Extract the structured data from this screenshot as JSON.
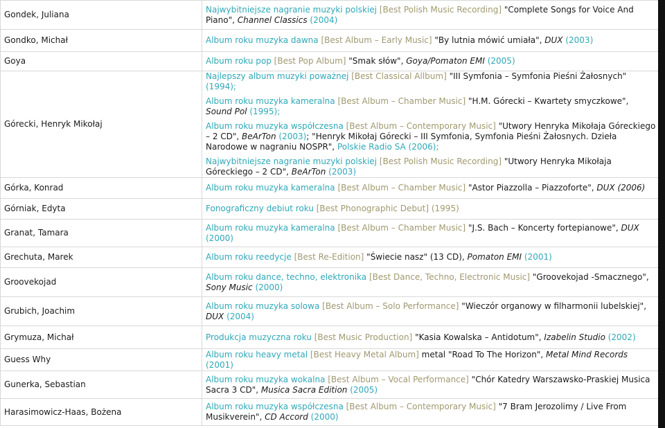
{
  "rows": [
    {
      "name": "Gondek, Juliana",
      "h": 42,
      "entries": [
        [
          {
            "t": "Najwybitniejsze nagranie muzyki polskiej",
            "c": "cat"
          },
          {
            "t": " [Best Polish Music Recording] ",
            "c": "en"
          },
          {
            "t": "\"Complete Songs for Voice And Piano\", ",
            "c": "pr"
          },
          {
            "t": "Channel Classics",
            "c": "lb"
          },
          {
            "t": " (2004)",
            "c": "yr"
          }
        ]
      ]
    },
    {
      "name": "Gondko, Michał",
      "h": 32,
      "entries": [
        [
          {
            "t": "Album roku muzyka dawna",
            "c": "cat"
          },
          {
            "t": " [Best Album – Early Music] ",
            "c": "en"
          },
          {
            "t": "\"By lutnia mówić umiała\", ",
            "c": "pr"
          },
          {
            "t": "DUX",
            "c": "lb"
          },
          {
            "t": " (2003)",
            "c": "yr"
          }
        ]
      ]
    },
    {
      "name": "Goya",
      "h": 28,
      "entries": [
        [
          {
            "t": "Album roku pop",
            "c": "cat"
          },
          {
            "t": " [Best Pop Album] ",
            "c": "en"
          },
          {
            "t": "\"Smak słów\", ",
            "c": "pr"
          },
          {
            "t": "Goya/Pomaton EMI",
            "c": "lb"
          },
          {
            "t": " (2005)",
            "c": "yr"
          }
        ]
      ]
    },
    {
      "name": "Górecki, Henryk Mikołaj",
      "h": 150,
      "entries": [
        [
          {
            "t": "Najlepszy album muzyki poważnej",
            "c": "cat"
          },
          {
            "t": " [Best Classical Allbum] ",
            "c": "en"
          },
          {
            "t": "\"III Symfonia – Symfonia Pieśni Żałosnych\" ",
            "c": "pr"
          },
          {
            "t": "(1994);",
            "c": "yr"
          }
        ],
        [
          {
            "t": "Album roku muzyka kameralna",
            "c": "cat"
          },
          {
            "t": " [Best Album – Chamber Music] ",
            "c": "en"
          },
          {
            "t": "\"H.M. Górecki – Kwartety smyczkowe\", ",
            "c": "pr"
          },
          {
            "t": "Sound Pol",
            "c": "lb"
          },
          {
            "t": " (1995);",
            "c": "yr"
          }
        ],
        [
          {
            "t": "Album roku muzyka współczesna",
            "c": "cat"
          },
          {
            "t": " [Best Album – Contemporary Music] ",
            "c": "en"
          },
          {
            "t": "\"Utwory Henryka Mikołaja Góreckiego – 2 CD\", ",
            "c": "pr"
          },
          {
            "t": "BeArTon",
            "c": "lb"
          },
          {
            "t": " (2003)",
            "c": "yr"
          },
          {
            "t": "; \"Henryk Mikołaj Górecki – III Symfonia, Symfonia Pieśni Żałosnych. Dzieła Narodowe w nagraniu NOSPR\", ",
            "c": "pr"
          },
          {
            "t": "Polskie Radio SA (2006);",
            "c": "yr"
          }
        ],
        [
          {
            "t": "Najwybitniejsze nagranie muzyki polskiej",
            "c": "cat"
          },
          {
            "t": " [Best Polish Music Recording] ",
            "c": "en"
          },
          {
            "t": "\"Utwory Henryka Mikołaja Góreckiego – 2 CD\", ",
            "c": "pr"
          },
          {
            "t": "BeArTon",
            "c": "lb"
          },
          {
            "t": " (2003)",
            "c": "yr"
          }
        ]
      ]
    },
    {
      "name": "Górka, Konrad",
      "h": 30,
      "entries": [
        [
          {
            "t": "Album roku muzyka kameralna",
            "c": "cat"
          },
          {
            "t": " [Best Album – Chamber Music] ",
            "c": "en"
          },
          {
            "t": "\"Astor Piazzolla – Piazzoforte\", ",
            "c": "pr"
          },
          {
            "t": "DUX (2006)",
            "c": "lb"
          }
        ]
      ]
    },
    {
      "name": "Górniak, Edyta",
      "h": 30,
      "entries": [
        [
          {
            "t": "Fonograficzny debiut roku",
            "c": "cat"
          },
          {
            "t": " [Best Phonographic Debut] ",
            "c": "en"
          },
          {
            "t": "(1995)",
            "c": "en"
          }
        ]
      ]
    },
    {
      "name": "Granat, Tamara",
      "h": 40,
      "entries": [
        [
          {
            "t": "Album roku muzyka kameralna",
            "c": "cat"
          },
          {
            "t": " [Best Album – Chamber Music] ",
            "c": "en"
          },
          {
            "t": "\"J.S. Bach – Koncerty fortepianowe\", ",
            "c": "pr"
          },
          {
            "t": "DUX",
            "c": "lb"
          },
          {
            "t": " (2000)",
            "c": "yr"
          }
        ]
      ]
    },
    {
      "name": "Grechuta, Marek",
      "h": 30,
      "entries": [
        [
          {
            "t": "Album roku reedycje",
            "c": "cat"
          },
          {
            "t": " [Best Re-Edition] ",
            "c": "en"
          },
          {
            "t": "\"Świecie nasz\" (13 CD), ",
            "c": "pr"
          },
          {
            "t": "Pomaton EMI",
            "c": "lb"
          },
          {
            "t": " (2001)",
            "c": "yr"
          }
        ]
      ]
    },
    {
      "name": "Groovekojad",
      "h": 42,
      "entries": [
        [
          {
            "t": "Album roku dance, techno, elektronika",
            "c": "cat"
          },
          {
            "t": " [Best Dance, Techno, Electronic Music] ",
            "c": "en"
          },
          {
            "t": "\"Groovekojad -Smacznego\", ",
            "c": "pr"
          },
          {
            "t": "Sony Music",
            "c": "lb"
          },
          {
            "t": " (2000)",
            "c": "yr"
          }
        ]
      ]
    },
    {
      "name": "Grubich, Joachim",
      "h": 42,
      "entries": [
        [
          {
            "t": "Album roku muzyka solowa",
            "c": "cat"
          },
          {
            "t": " [Best Album – Solo Performance] ",
            "c": "en"
          },
          {
            "t": "\"Wieczór organowy w filharmonii lubelskiej\", ",
            "c": "pr"
          },
          {
            "t": "DUX",
            "c": "lb"
          },
          {
            "t": " (2004)",
            "c": "yr"
          }
        ]
      ]
    },
    {
      "name": "Grymuza, Michał",
      "h": 33,
      "entries": [
        [
          {
            "t": "Produkcja muzyczna roku",
            "c": "cat"
          },
          {
            "t": " [Best Music Production] ",
            "c": "en"
          },
          {
            "t": "\"Kasia Kowalska – Antidotum\", ",
            "c": "pr"
          },
          {
            "t": "Izabelin Studio",
            "c": "lb"
          },
          {
            "t": " (2002)",
            "c": "yr"
          }
        ]
      ]
    },
    {
      "name": "Guess Why",
      "h": 32,
      "entries": [
        [
          {
            "t": "Album roku heavy metal",
            "c": "cat"
          },
          {
            "t": " [Best Heavy Metal Album] ",
            "c": "en"
          },
          {
            "t": "metal \"Road To The Horizon\", ",
            "c": "pr"
          },
          {
            "t": "Metal Mind Records",
            "c": "lb"
          },
          {
            "t": " (2001)",
            "c": "yr"
          }
        ]
      ]
    },
    {
      "name": "Gunerka, Sebastian",
      "h": 40,
      "entries": [
        [
          {
            "t": "Album roku muzyka wokalna",
            "c": "cat"
          },
          {
            "t": " [Best Album – Vocal Performance] ",
            "c": "en"
          },
          {
            "t": "\"Chór Katedry Warszawsko-Praskiej Musica Sacra 3 CD\", ",
            "c": "pr"
          },
          {
            "t": "Musica Sacra Edition",
            "c": "lb"
          },
          {
            "t": " (2005)",
            "c": "yr"
          }
        ]
      ]
    },
    {
      "name": "Harasimowicz-Haas, Bożena",
      "h": 39,
      "entries": [
        [
          {
            "t": "Album roku muzyka współczesna",
            "c": "cat"
          },
          {
            "t": " [Best Album – Contemporary Music] ",
            "c": "en"
          },
          {
            "t": "\"7 Bram Jerozolimy / Live From Musikverein\", ",
            "c": "pr"
          },
          {
            "t": "CD Accord",
            "c": "lb"
          },
          {
            "t": " (2000)",
            "c": "yr"
          }
        ]
      ]
    }
  ]
}
